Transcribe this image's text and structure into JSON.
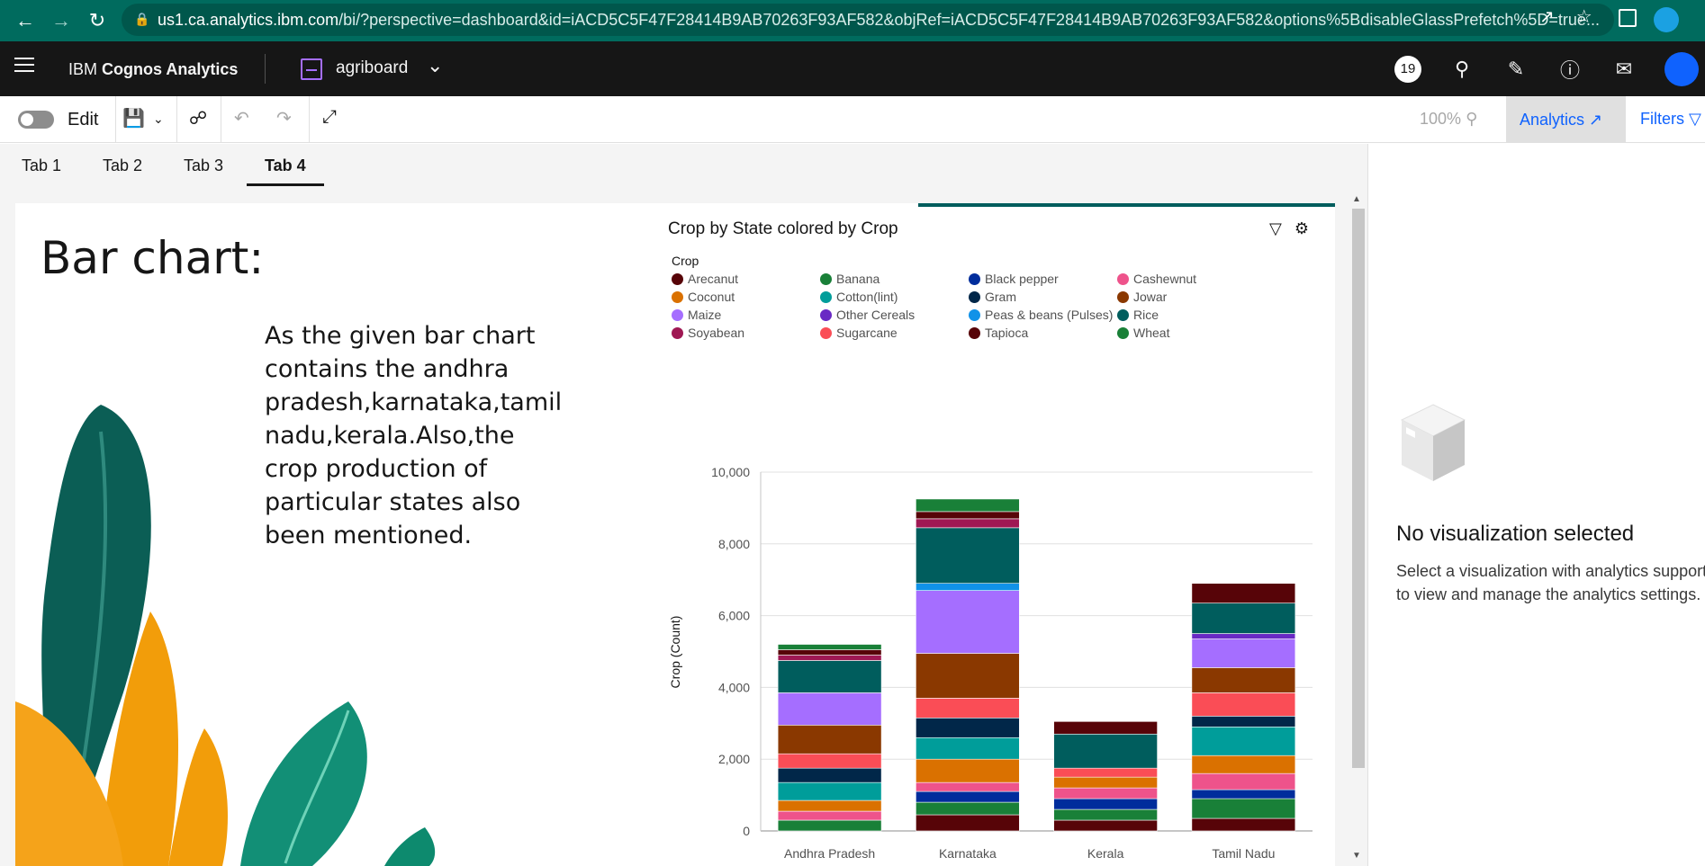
{
  "browser": {
    "url_host": "us1.ca.analytics.ibm.com",
    "url_rest": "/bi/?perspective=dashboard&id=iACD5C5F47F28414B9AB70263F93AF582&objRef=iACD5C5F47F28414B9AB70263F93AF582&options%5BdisableGlassPrefetch%5D=true..."
  },
  "app": {
    "brand_prefix": "IBM ",
    "brand_name": "Cognos Analytics",
    "dashboard_name": "agriboard",
    "notification_count": "19"
  },
  "toolbar": {
    "edit_label": "Edit",
    "zoom": "100%",
    "analytics_label": "Analytics",
    "filters_label": "Filters"
  },
  "tabs": [
    "Tab 1",
    "Tab 2",
    "Tab 3",
    "Tab 4"
  ],
  "active_tab": "Tab 4",
  "canvas": {
    "headline": "Bar chart:",
    "paragraph": "As the given bar chart contains the andhra pradesh,karnataka,tamil nadu,kerala.Also,the crop production of particular states also been mentioned."
  },
  "right_panel": {
    "title": "No visualization selected",
    "description": "Select a visualization with analytics support to view and manage the analytics settings."
  },
  "chart_data": {
    "type": "bar",
    "stacked": true,
    "title": "Crop by State colored by Crop",
    "legend_title": "Crop",
    "legend_position": "top",
    "xlabel": "",
    "ylabel": "Crop (Count)",
    "ylim": [
      0,
      10000
    ],
    "yticks": [
      0,
      2000,
      4000,
      6000,
      8000,
      10000
    ],
    "ytick_labels": [
      "0",
      "2,000",
      "4,000",
      "6,000",
      "8,000",
      "10,000"
    ],
    "categories": [
      "Andhra Pradesh",
      "Karnataka",
      "Kerala",
      "Tamil Nadu"
    ],
    "grid": true,
    "series": [
      {
        "name": "Arecanut",
        "color": "#570408",
        "values": [
          0,
          450,
          300,
          350
        ]
      },
      {
        "name": "Banana",
        "color": "#198038",
        "values": [
          300,
          350,
          300,
          550
        ]
      },
      {
        "name": "Black pepper",
        "color": "#002d9c",
        "values": [
          0,
          300,
          300,
          250
        ]
      },
      {
        "name": "Cashewnut",
        "color": "#ee538b",
        "values": [
          250,
          250,
          300,
          450
        ]
      },
      {
        "name": "Coconut",
        "color": "#da7100",
        "values": [
          300,
          650,
          300,
          500
        ]
      },
      {
        "name": "Cotton(lint)",
        "color": "#1192e8",
        "values": [
          0,
          0,
          0,
          0
        ]
      },
      {
        "name": "Cotton(lint)",
        "color": "#009d9a",
        "values": [
          500,
          600,
          0,
          800
        ]
      },
      {
        "name": "Gram",
        "color": "#012749",
        "values": [
          400,
          550,
          0,
          300
        ]
      },
      {
        "name": "Sugarcane",
        "color": "#fa4d56",
        "values": [
          400,
          550,
          250,
          650
        ]
      },
      {
        "name": "Jowar",
        "color": "#8a3800",
        "values": [
          800,
          1250,
          0,
          700
        ]
      },
      {
        "name": "Maize",
        "color": "#a56eff",
        "values": [
          900,
          1750,
          0,
          800
        ]
      },
      {
        "name": "Other Cereals",
        "color": "#6929c4",
        "values": [
          0,
          0,
          0,
          150
        ]
      },
      {
        "name": "Peas & beans (Pulses)",
        "color": "#1192e8",
        "values": [
          0,
          200,
          0,
          0
        ]
      },
      {
        "name": "Rice",
        "color": "#005d5d",
        "values": [
          900,
          1550,
          950,
          850
        ]
      },
      {
        "name": "Soyabean",
        "color": "#9f1853",
        "values": [
          150,
          250,
          0,
          0
        ]
      },
      {
        "name": "Tapioca",
        "color": "#570408",
        "values": [
          150,
          200,
          350,
          550
        ]
      },
      {
        "name": "Wheat",
        "color": "#198038",
        "values": [
          150,
          350,
          0,
          0
        ]
      }
    ],
    "legend": [
      {
        "name": "Arecanut",
        "color": "#570408"
      },
      {
        "name": "Banana",
        "color": "#198038"
      },
      {
        "name": "Black pepper",
        "color": "#002d9c"
      },
      {
        "name": "Cashewnut",
        "color": "#ee538b"
      },
      {
        "name": "Coconut",
        "color": "#da7100"
      },
      {
        "name": "Cotton(lint)",
        "color": "#009d9a"
      },
      {
        "name": "Gram",
        "color": "#012749"
      },
      {
        "name": "Jowar",
        "color": "#8a3800"
      },
      {
        "name": "Maize",
        "color": "#a56eff"
      },
      {
        "name": "Other Cereals",
        "color": "#6929c4"
      },
      {
        "name": "Peas & beans (Pulses)",
        "color": "#1192e8"
      },
      {
        "name": "Rice",
        "color": "#005d5d"
      },
      {
        "name": "Soyabean",
        "color": "#9f1853"
      },
      {
        "name": "Sugarcane",
        "color": "#fa4d56"
      },
      {
        "name": "Tapioca",
        "color": "#570408"
      },
      {
        "name": "Wheat",
        "color": "#198038"
      }
    ]
  }
}
